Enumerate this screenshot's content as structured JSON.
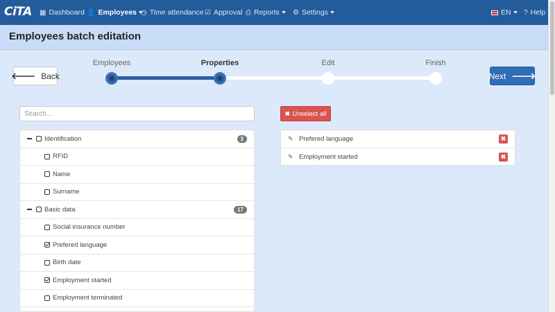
{
  "nav": {
    "logo": "CiTA",
    "items": [
      {
        "icon": "dashboard-icon",
        "glyph": "▦",
        "label": "Dashboard"
      },
      {
        "icon": "user-icon",
        "glyph": "👤",
        "label": "Employees"
      },
      {
        "icon": "clock-icon",
        "glyph": "◷",
        "label": "Time attendance"
      },
      {
        "icon": "check-square-icon",
        "glyph": "☑",
        "label": "Approval"
      },
      {
        "icon": "print-icon",
        "glyph": "⎙",
        "label": "Reports"
      },
      {
        "icon": "gear-icon",
        "glyph": "⚙",
        "label": "Settings"
      }
    ],
    "language": "EN",
    "help": "Help",
    "help_glyph": "?"
  },
  "page": {
    "title": "Employees batch editation"
  },
  "wizard": {
    "back_label": "Back",
    "back_glyph": "🡐",
    "next_label": "Next",
    "next_glyph": "🡒",
    "steps": [
      {
        "label": "Employees",
        "state": "done"
      },
      {
        "label": "Properties",
        "state": "current"
      },
      {
        "label": "Edit",
        "state": "todo"
      },
      {
        "label": "Finish",
        "state": "todo"
      }
    ]
  },
  "search": {
    "placeholder": "Search..."
  },
  "tree": {
    "groups": [
      {
        "label": "Identification",
        "count": "3",
        "children": [
          {
            "label": "RFID",
            "checked": false
          },
          {
            "label": "Name",
            "checked": false
          },
          {
            "label": "Surname",
            "checked": false
          }
        ]
      },
      {
        "label": "Basic data",
        "count": "17",
        "children": [
          {
            "label": "Social insurance number",
            "checked": false
          },
          {
            "label": "Prefered language",
            "checked": true
          },
          {
            "label": "Birth date",
            "checked": false
          },
          {
            "label": "Employment started",
            "checked": true
          },
          {
            "label": "Employment terminated",
            "checked": false
          }
        ]
      }
    ]
  },
  "selection": {
    "unselect_label": "Unselect all",
    "unselect_glyph": "✖",
    "remove_glyph": "✖",
    "edit_glyph": "✎",
    "items": [
      "Prefered language",
      "Employment started"
    ]
  },
  "colors": {
    "navbar": "#235c9b",
    "accent": "#2f6db5",
    "danger": "#d9534f",
    "background": "#dbe9fb"
  }
}
